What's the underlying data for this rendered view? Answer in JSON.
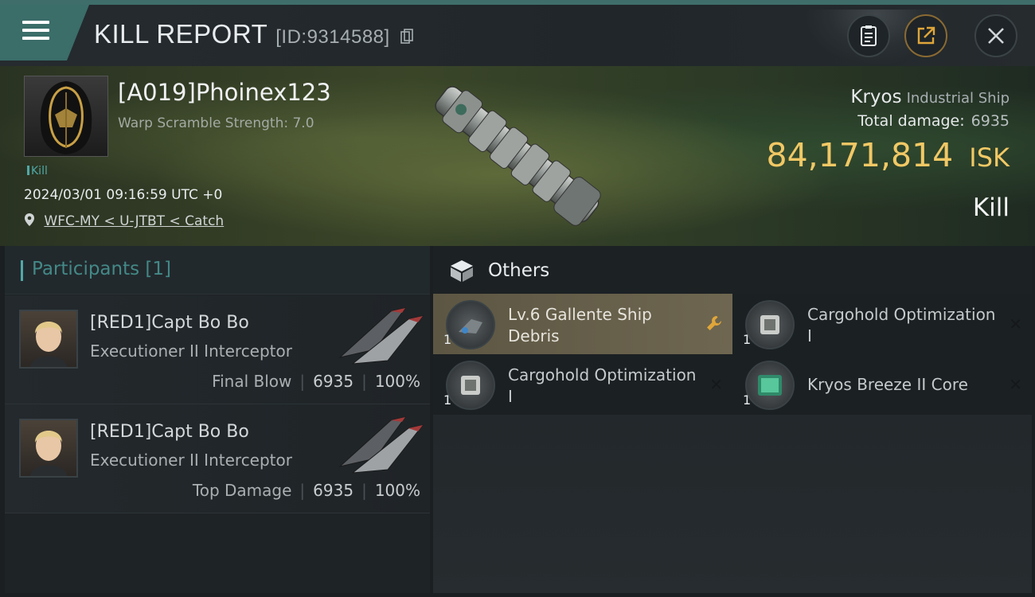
{
  "header": {
    "title": "KILL REPORT",
    "report_id": "[ID:9314588]",
    "icons": [
      "menu-icon",
      "copy-icon",
      "clipboard-icon",
      "share-icon",
      "close-icon"
    ]
  },
  "attacker": {
    "name": "[A019]Phoinex123",
    "warp_scramble": "Warp Scramble Strength: 7.0",
    "tag": "Kill",
    "datetime": "2024/03/01 09:16:59 UTC +0",
    "location": "WFC-MY < U-JTBT < Catch"
  },
  "victim": {
    "ship": "Kryos",
    "ship_class": "Industrial Ship",
    "total_damage_label": "Total damage:",
    "total_damage": "6935",
    "isk_value": "84,171,814",
    "isk_unit": "ISK",
    "result": "Kill"
  },
  "participants": {
    "header": "Participants",
    "count": "[1]",
    "items": [
      {
        "name": "[RED1]Capt Bo Bo",
        "ship": "Executioner II Interceptor",
        "role": "Final Blow",
        "damage": "6935",
        "percent": "100%"
      },
      {
        "name": "[RED1]Capt Bo Bo",
        "ship": "Executioner II Interceptor",
        "role": "Top Damage",
        "damage": "6935",
        "percent": "100%"
      }
    ]
  },
  "others": {
    "header": "Others",
    "items": [
      {
        "name": "Lv.6 Gallente Ship Debris",
        "qty": "1",
        "action_icon": "wrench-icon",
        "highlighted": true
      },
      {
        "name": "Cargohold Optimization I",
        "qty": "1",
        "action_icon": "close-icon"
      },
      {
        "name": "Cargohold Optimization I",
        "qty": "1",
        "action_icon": "close-icon"
      },
      {
        "name": "Kryos Breeze II Core",
        "qty": "1",
        "action_icon": "close-icon"
      }
    ]
  },
  "colors": {
    "accent_teal": "#4fa9a6",
    "isk_gold": "#f1c865",
    "highlight": "#6e6650",
    "wrench": "#e0a63a"
  }
}
